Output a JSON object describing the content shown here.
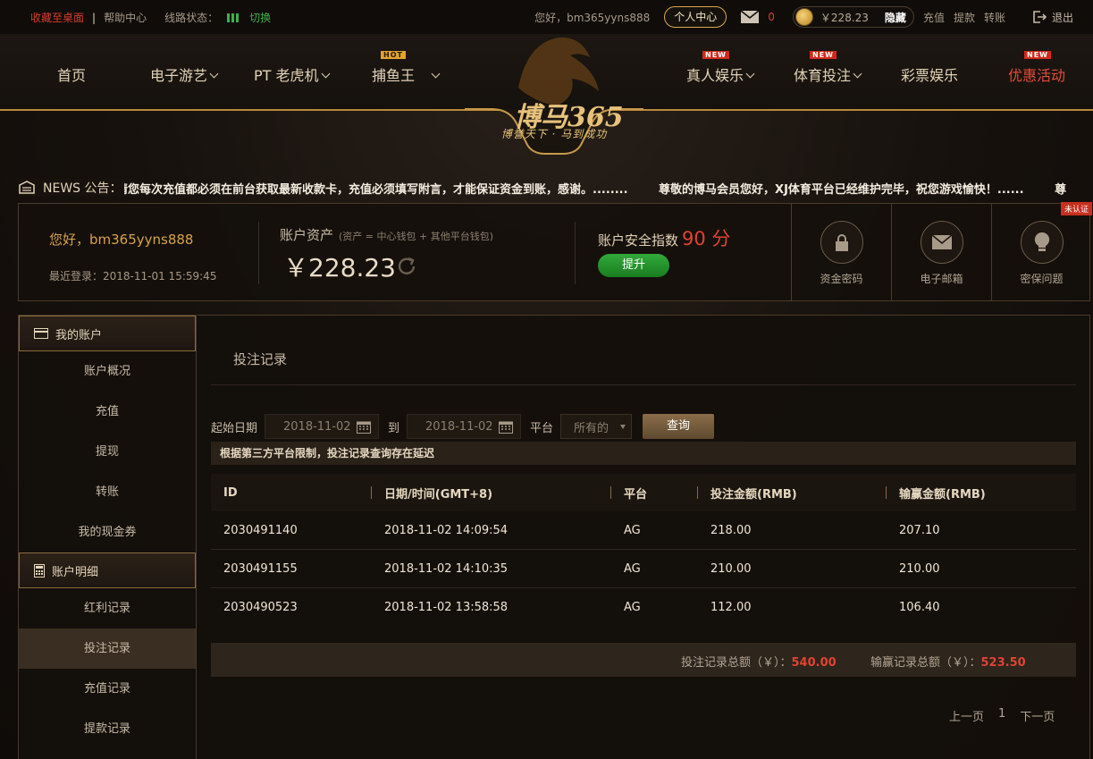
{
  "topbar": {
    "fav_label": "收藏至桌面",
    "help_label": "帮助中心",
    "line_status_label": "线路状态：",
    "switch_label": "切换",
    "greeting": "您好，bm365yyns888",
    "user_center_label": "个人中心",
    "mail_count": "0",
    "balance": "￥228.23",
    "hide_label": "隐藏",
    "deposit_label": "充值",
    "withdraw_label": "提款",
    "transfer_label": "转账",
    "logout_label": "退出"
  },
  "nav": {
    "home": "首页",
    "egames": "电子游艺",
    "pt": "PT 老虎机",
    "fishing": "捕鱼王",
    "live": "真人娱乐",
    "sports": "体育投注",
    "lottery": "彩票娱乐",
    "promo": "优惠活动",
    "badge_hot": "HOT",
    "badge_new": "NEW"
  },
  "logo": {
    "text": "博马365",
    "slogan": "博誉天下 · 马到成功"
  },
  "news": {
    "label": "NEWS 公告：",
    "items": [
      "请您每次充值都必须在前台获取最新收款卡，充值必须填写附言，才能保证资金到账，感谢。........",
      "尊敬的博马会员您好，XJ体育平台已经维护完毕，祝您游戏愉快！......",
      "尊"
    ]
  },
  "account": {
    "hello": "您好，bm365yyns888",
    "last_login": "最近登录：2018-11-01 15:59:45",
    "asset_title": "账户资产",
    "asset_note": "(资产 = 中心钱包 + 其他平台钱包)",
    "asset_value": "￥228.23",
    "security_title": "账户安全指数",
    "security_score": "90 分",
    "upgrade_label": "提升",
    "security_items": [
      "资金密码",
      "电子邮箱",
      "密保问题"
    ],
    "unverified_label": "未认证"
  },
  "sidebar": {
    "section1": "我的账户",
    "items1": [
      "账户概况",
      "充值",
      "提现",
      "转账",
      "我的现金券"
    ],
    "section2": "账户明细",
    "items2": [
      "红利记录",
      "投注记录",
      "充值记录",
      "提款记录"
    ]
  },
  "main": {
    "title": "投注记录",
    "start_label": "起始日期",
    "start_date": "2018-11-02",
    "to_label": "到",
    "end_date": "2018-11-02",
    "platform_label": "平台",
    "platform_value": "所有的",
    "query_label": "查询",
    "notice": "根据第三方平台限制，投注记录查询存在延迟",
    "columns": [
      "ID",
      "日期/时间(GMT+8)",
      "平台",
      "投注金额(RMB)",
      "输赢金额(RMB)"
    ],
    "rows": [
      [
        "2030491140",
        "2018-11-02 14:09:54",
        "AG",
        "218.00",
        "207.10"
      ],
      [
        "2030491155",
        "2018-11-02 14:10:35",
        "AG",
        "210.00",
        "210.00"
      ],
      [
        "2030490523",
        "2018-11-02 13:58:58",
        "AG",
        "112.00",
        "106.40"
      ]
    ],
    "bet_total_label": "投注记录总额（￥）：",
    "bet_total": "540.00",
    "win_total_label": "输赢记录总额（￥）：",
    "win_total": "523.50",
    "prev_label": "上一页",
    "page": "1",
    "next_label": "下一页"
  }
}
